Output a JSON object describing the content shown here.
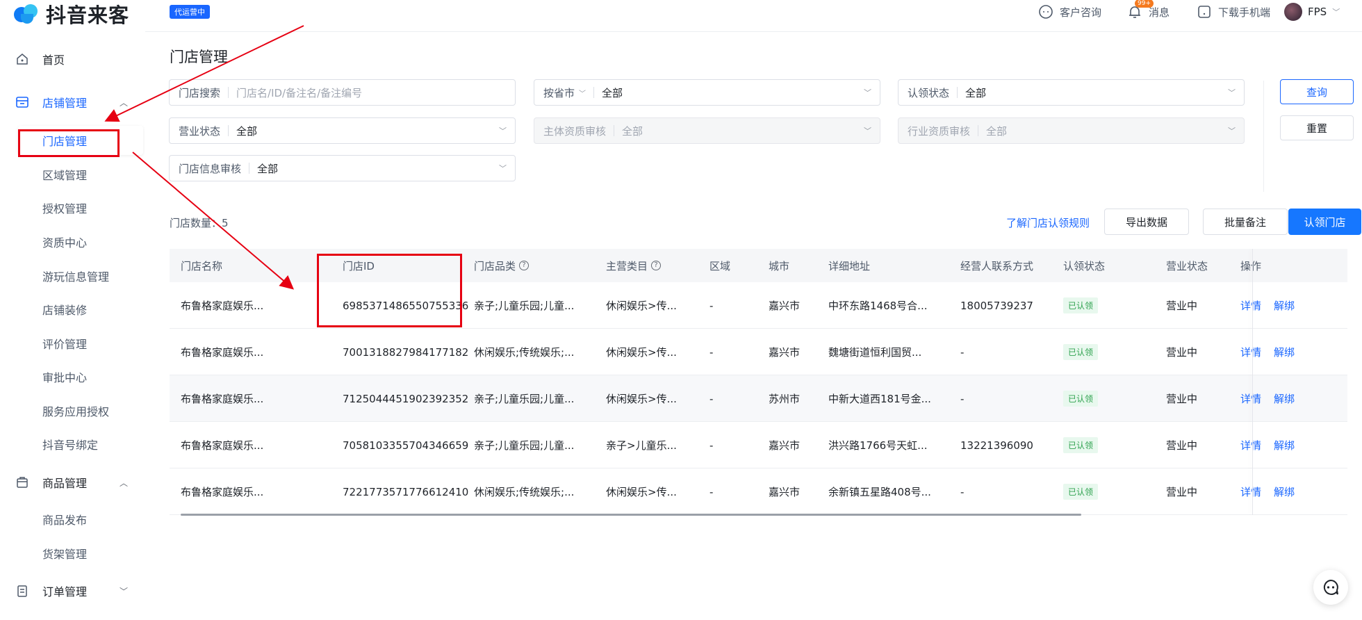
{
  "app": {
    "logo_text": "抖音来客",
    "agent_badge": "代运营中"
  },
  "header": {
    "customer_service": "客户咨询",
    "messages": "消息",
    "messages_badge": "99+",
    "download_app": "下载手机端",
    "user_name": "FPS"
  },
  "sidebar": {
    "home": "首页",
    "store_group": "店铺管理",
    "store_items": [
      "门店管理",
      "区域管理",
      "授权管理",
      "资质中心",
      "游玩信息管理",
      "店铺装修",
      "评价管理",
      "审批中心",
      "服务应用授权",
      "抖音号绑定"
    ],
    "goods_group": "商品管理",
    "goods_items": [
      "商品发布",
      "货架管理"
    ],
    "order_group": "订单管理"
  },
  "page": {
    "title": "门店管理",
    "filters": {
      "search_label": "门店搜索",
      "search_placeholder": "门店名/ID/备注名/备注编号",
      "province_label": "按省市",
      "province_value": "全部",
      "claim_label": "认领状态",
      "claim_value": "全部",
      "business_label": "营业状态",
      "business_value": "全部",
      "subject_label": "主体资质审核",
      "subject_value": "全部",
      "industry_label": "行业资质审核",
      "industry_value": "全部",
      "info_label": "门店信息审核",
      "info_value": "全部"
    },
    "query_button": "查询",
    "reset_button": "重置",
    "count_label": "门店数量：5",
    "rules_link": "了解门店认领规则",
    "export_button": "导出数据",
    "batch_note_button": "批量备注",
    "claim_button": "认领门店"
  },
  "table": {
    "headers": [
      "门店名称",
      "门店ID",
      "门店品类",
      "主营类目",
      "区域",
      "城市",
      "详细地址",
      "经营人联系方式",
      "认领状态",
      "营业状态",
      "操作"
    ],
    "rows": [
      {
        "name": "布鲁格家庭娱乐...",
        "id": "6985371486550755336",
        "category": "亲子;儿童乐园;儿童...",
        "main": "休闲娱乐>传...",
        "region": "-",
        "city": "嘉兴市",
        "address": "中环东路1468号合...",
        "contact": "18005739237",
        "claim": "已认领",
        "status": "营业中",
        "op1": "详情",
        "op2": "解绑"
      },
      {
        "name": "布鲁格家庭娱乐...",
        "id": "7001318827984177182",
        "category": "休闲娱乐;传统娱乐;...",
        "main": "休闲娱乐>传...",
        "region": "-",
        "city": "嘉兴市",
        "address": "魏塘街道恒利国贸...",
        "contact": "-",
        "claim": "已认领",
        "status": "营业中",
        "op1": "详情",
        "op2": "解绑"
      },
      {
        "name": "布鲁格家庭娱乐...",
        "id": "7125044451902392352",
        "category": "亲子;儿童乐园;儿童...",
        "main": "休闲娱乐>传...",
        "region": "-",
        "city": "苏州市",
        "address": "中新大道西181号金...",
        "contact": "-",
        "claim": "已认领",
        "status": "营业中",
        "op1": "详情",
        "op2": "解绑"
      },
      {
        "name": "布鲁格家庭娱乐...",
        "id": "7058103355704346659",
        "category": "亲子;儿童乐园;儿童...",
        "main": "亲子>儿童乐...",
        "region": "-",
        "city": "嘉兴市",
        "address": "洪兴路1766号天虹...",
        "contact": "13221396090",
        "claim": "已认领",
        "status": "营业中",
        "op1": "详情",
        "op2": "解绑"
      },
      {
        "name": "布鲁格家庭娱乐...",
        "id": "7221773571776612410",
        "category": "休闲娱乐;传统娱乐;...",
        "main": "休闲娱乐>传...",
        "region": "-",
        "city": "嘉兴市",
        "address": "余新镇五星路408号...",
        "contact": "-",
        "claim": "已认领",
        "status": "营业中",
        "op1": "详情",
        "op2": "解绑"
      }
    ]
  },
  "colors": {
    "primary": "#1966ff",
    "annotation": "#e60012",
    "claimed_tag": "#2fa24f"
  }
}
